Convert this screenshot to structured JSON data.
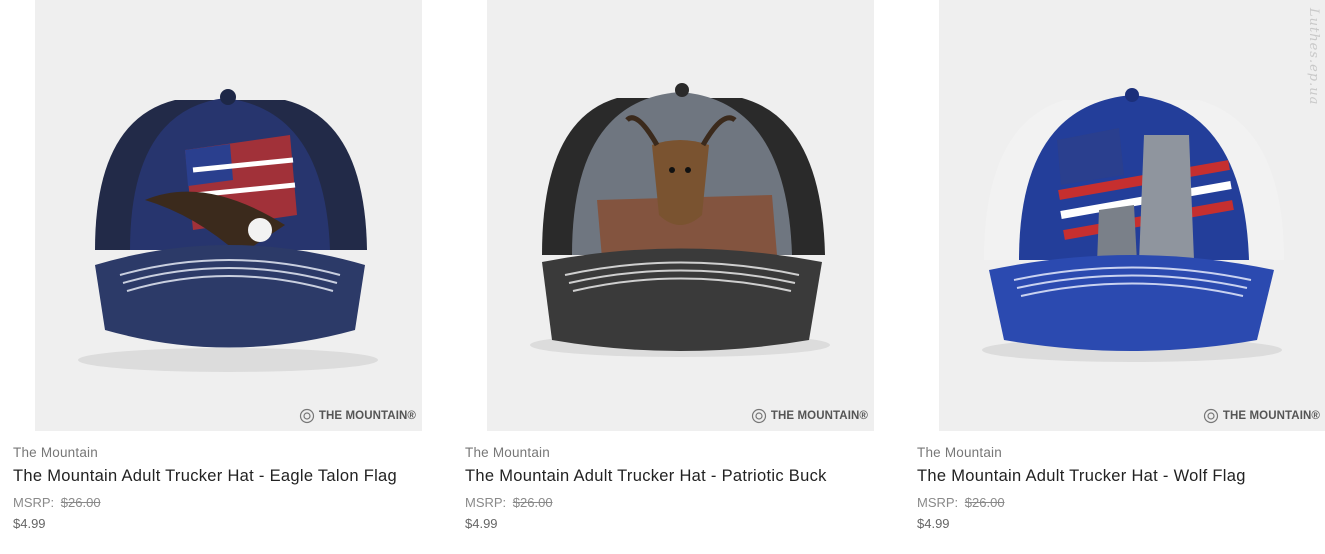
{
  "products": [
    {
      "brand": "The Mountain",
      "title": "The Mountain Adult Trucker Hat - Eagle Talon Flag",
      "msrp_label": "MSRP:",
      "msrp_price": "$26.00",
      "price": "$4.99",
      "logo_text": "THE MOUNTAIN®",
      "crown_color": "#27356e",
      "mesh_color": "#222a48",
      "brim_color": "#2c3a68"
    },
    {
      "brand": "The Mountain",
      "title": "The Mountain Adult Trucker Hat - Patriotic Buck",
      "msrp_label": "MSRP:",
      "msrp_price": "$26.00",
      "price": "$4.99",
      "logo_text": "THE MOUNTAIN®",
      "crown_color": "#6f7680",
      "mesh_color": "#2a2a2a",
      "brim_color": "#3a3a3a"
    },
    {
      "brand": "The Mountain",
      "title": "The Mountain Adult Trucker Hat - Wolf Flag",
      "msrp_label": "MSRP:",
      "msrp_price": "$26.00",
      "price": "$4.99",
      "logo_text": "THE MOUNTAIN®",
      "crown_color": "#233e9a",
      "mesh_color": "#f2f2f2",
      "brim_color": "#2b4ab0"
    }
  ],
  "watermark": "Luthes.ep.ua"
}
